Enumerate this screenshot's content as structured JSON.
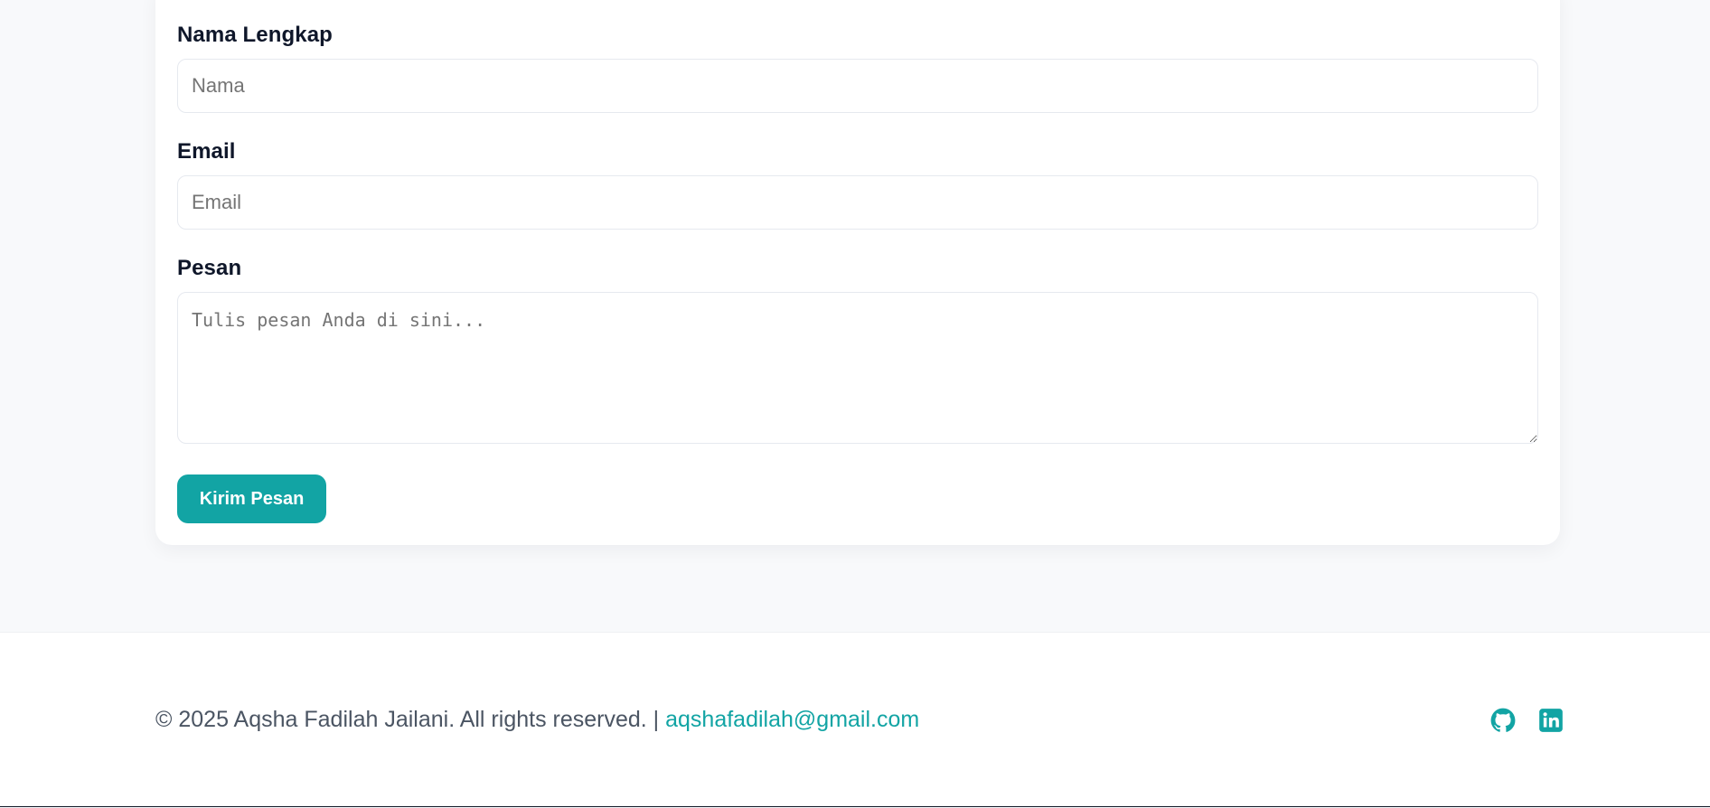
{
  "form": {
    "name": {
      "label": "Nama Lengkap",
      "placeholder": "Nama",
      "value": ""
    },
    "email": {
      "label": "Email",
      "placeholder": "Email",
      "value": ""
    },
    "message": {
      "label": "Pesan",
      "placeholder": "Tulis pesan Anda di sini...",
      "value": ""
    },
    "submit_label": "Kirim Pesan"
  },
  "footer": {
    "copyright": "© 2025 Aqsha Fadilah Jailani. All rights reserved.",
    "separator": " | ",
    "email": "aqshafadilah@gmail.com",
    "social": [
      {
        "icon": "github-icon"
      },
      {
        "icon": "linkedin-icon"
      }
    ]
  },
  "colors": {
    "accent": "#12a4a4",
    "page_background": "#f8f9fb",
    "card_background": "#ffffff",
    "text": "#0f172a",
    "muted_text": "#4b5563"
  }
}
